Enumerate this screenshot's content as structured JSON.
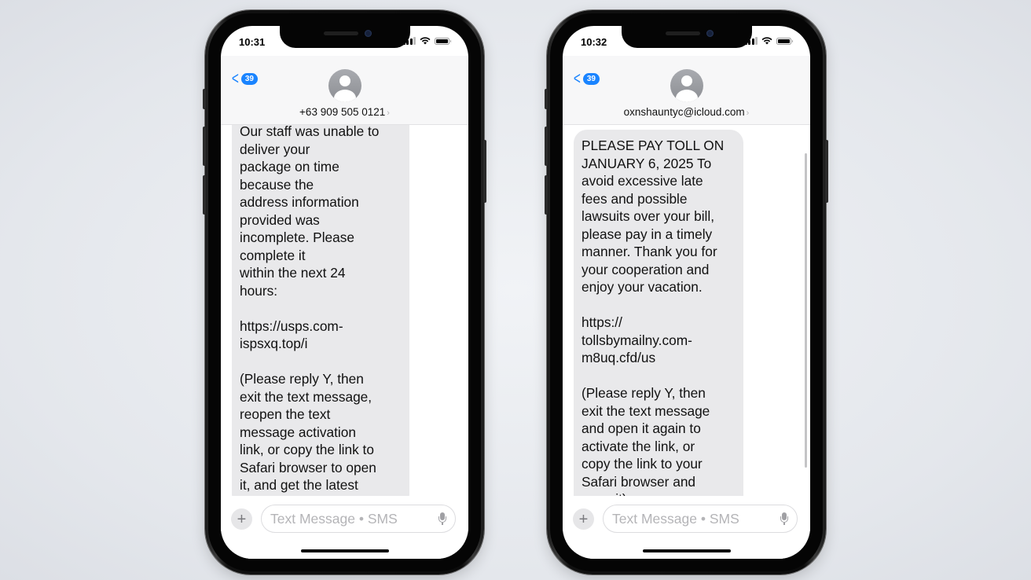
{
  "accent_color": "#1a84ff",
  "phones": [
    {
      "status": {
        "time": "10:31"
      },
      "header": {
        "back_badge": "39",
        "contact": "+63 909 505 0121",
        "contact_chevron": "›"
      },
      "message": "Our staff was unable to\ndeliver your\npackage on time\nbecause the\naddress information\nprovided was\nincomplete. Please\ncomplete it\nwithin the next 24\nhours:\n\nhttps://usps.com-\nispsxq.top/i\n\n(Please reply Y, then\nexit the text message,\nreopen the text\nmessage activation\nlink, or copy the link to\nSafari browser to open\nit, and get the latest\nlogistics status)",
      "composer": {
        "plus": "+",
        "placeholder": "Text Message • SMS"
      }
    },
    {
      "status": {
        "time": "10:32"
      },
      "header": {
        "back_badge": "39",
        "contact": "oxnshauntyc@icloud.com",
        "contact_chevron": "›"
      },
      "message": "PLEASE PAY TOLL ON\nJANUARY 6, 2025 To\navoid excessive late\nfees and possible\nlawsuits over your bill,\nplease pay in a timely\nmanner. Thank you for\nyour cooperation and\nenjoy your vacation.\n\nhttps://\ntollsbymailny.com-\nm8uq.cfd/us\n\n(Please reply Y, then\nexit the text message\nand open it again to\nactivate the link, or\ncopy the link to your\nSafari browser and\nopen it)",
      "composer": {
        "plus": "+",
        "placeholder": "Text Message • SMS"
      }
    }
  ]
}
